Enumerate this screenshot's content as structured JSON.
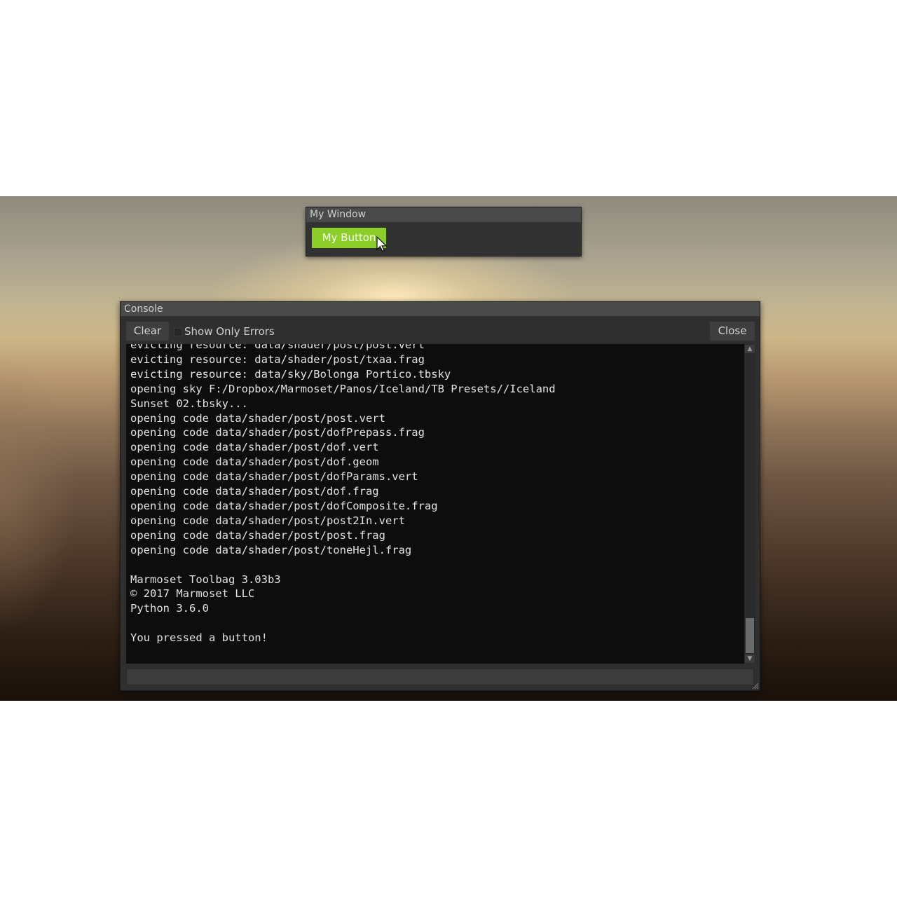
{
  "my_window": {
    "title": "My Window",
    "button_label": "My Button"
  },
  "console": {
    "title": "Console",
    "clear_label": "Clear",
    "show_errors_label": "Show Only Errors",
    "show_errors_checked": false,
    "close_label": "Close",
    "input_value": "",
    "log_lines": [
      "evicting resource: data/shader/post/post.vert",
      "evicting resource: data/shader/post/txaa.frag",
      "evicting resource: data/sky/Bolonga Portico.tbsky",
      "opening sky F:/Dropbox/Marmoset/Panos/Iceland/TB Presets//Iceland",
      "Sunset 02.tbsky...",
      "opening code data/shader/post/post.vert",
      "opening code data/shader/post/dofPrepass.frag",
      "opening code data/shader/post/dof.vert",
      "opening code data/shader/post/dof.geom",
      "opening code data/shader/post/dofParams.vert",
      "opening code data/shader/post/dof.frag",
      "opening code data/shader/post/dofComposite.frag",
      "opening code data/shader/post/post2In.vert",
      "opening code data/shader/post/post.frag",
      "opening code data/shader/post/toneHejl.frag",
      "",
      "Marmoset Toolbag 3.03b3",
      "© 2017 Marmoset LLC",
      "Python 3.6.0",
      "",
      "You pressed a button!"
    ]
  },
  "colors": {
    "accent_button": "#8ccd2a",
    "panel": "#2f2f2f",
    "titlebar": "#4a4a4a",
    "log_bg": "#0d0d0d"
  }
}
